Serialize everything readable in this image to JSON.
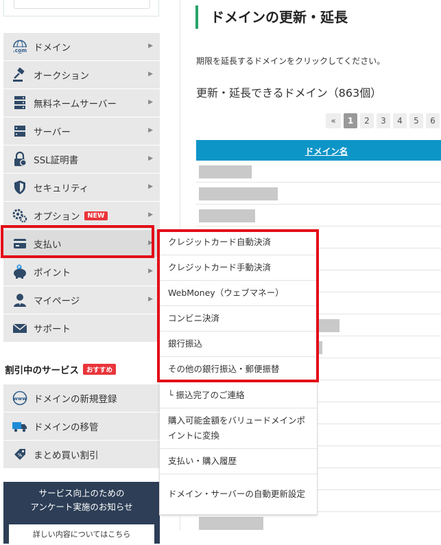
{
  "sidebar": {
    "menu": [
      {
        "label": "ドメイン",
        "icon": "globe-com-icon"
      },
      {
        "label": "オークション",
        "icon": "gavel-icon"
      },
      {
        "label": "無料ネームサーバー",
        "icon": "server-stack-icon"
      },
      {
        "label": "サーバー",
        "icon": "server-icon"
      },
      {
        "label": "SSL証明書",
        "icon": "ssl-lock-icon"
      },
      {
        "label": "セキュリティ",
        "icon": "shield-icon"
      },
      {
        "label": "オプション",
        "icon": "gear-icon",
        "badge": "NEW"
      },
      {
        "label": "支払い",
        "icon": "card-icon"
      },
      {
        "label": "ポイント",
        "icon": "piggy-bank-icon"
      },
      {
        "label": "マイページ",
        "icon": "user-icon"
      },
      {
        "label": "サポート",
        "icon": "mail-icon"
      }
    ],
    "discount_section": {
      "title": "割引中のサービス",
      "badge": "おすすめ",
      "items": [
        {
          "label": "ドメインの新規登録",
          "icon": "www-icon"
        },
        {
          "label": "ドメインの移管",
          "icon": "truck-icon"
        },
        {
          "label": "まとめ買い割引",
          "icon": "tag-icon"
        }
      ]
    },
    "survey": {
      "line1": "サービス向上のための",
      "line2": "アンケート実施のお知らせ",
      "more": "詳しい内容についてはこちら"
    }
  },
  "main": {
    "title": "ドメインの更新・延長",
    "instruction": "期限を延長するドメインをクリックしてください。",
    "count_label": "更新・延長できるドメイン（863個）",
    "pagination": [
      "«",
      "1",
      "2",
      "3",
      "4",
      "5",
      "6"
    ],
    "active_page": "1",
    "table_header": "ドメイン名"
  },
  "submenu": {
    "items": [
      {
        "label": "クレジットカード自動決済"
      },
      {
        "label": "クレジットカード手動決済"
      },
      {
        "label": "WebMoney（ウェブマネー）"
      },
      {
        "label": "コンビニ決済"
      },
      {
        "label": "銀行振込"
      },
      {
        "label": "その他の銀行振込・郵便振替"
      },
      {
        "label": "└ 振込完了のご連絡"
      },
      {
        "label": "購入可能金額をバリュードメインポイントに変換"
      },
      {
        "label": "支払い・購入履歴"
      },
      {
        "label": "ドメイン・サーバーの自動更新設定"
      }
    ]
  },
  "colors": {
    "accent_green": "#27a36a",
    "table_header_blue": "#0d95c7",
    "highlight_red": "#e30c17",
    "badge_red": "#e9353b",
    "survey_navy": "#2d3e56"
  }
}
